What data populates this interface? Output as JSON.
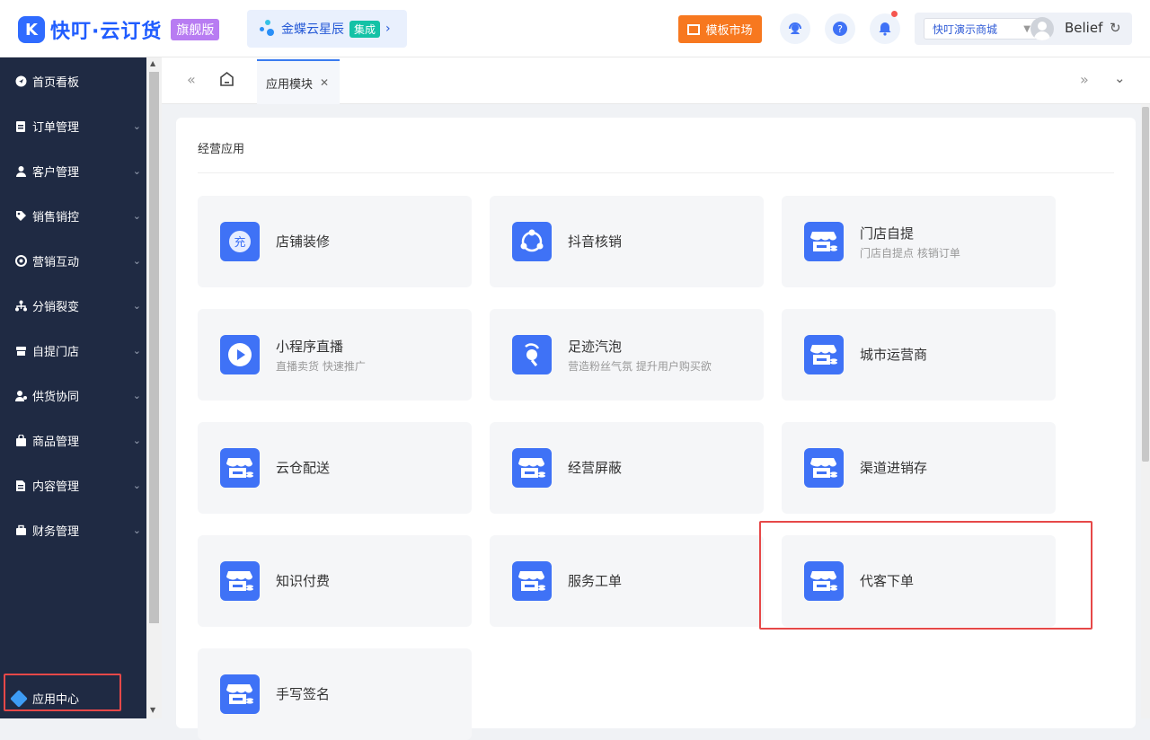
{
  "header": {
    "logo_text": "快叮·云订货",
    "edition": "旗舰版",
    "kingdee_text": "金蝶云星辰",
    "kingdee_badge": "集成",
    "template_market": "模板市场",
    "store": "快叮演示商城",
    "username": "Belief"
  },
  "sidebar": {
    "items": [
      {
        "label": "首页看板",
        "icon": "send-icon"
      },
      {
        "label": "订单管理",
        "icon": "clipboard-icon"
      },
      {
        "label": "客户管理",
        "icon": "user-icon"
      },
      {
        "label": "销售销控",
        "icon": "tag-icon"
      },
      {
        "label": "营销互动",
        "icon": "target-icon"
      },
      {
        "label": "分销裂变",
        "icon": "hierarchy-icon"
      },
      {
        "label": "自提门店",
        "icon": "store-icon"
      },
      {
        "label": "供货协同",
        "icon": "user-share-icon"
      },
      {
        "label": "商品管理",
        "icon": "bag-icon"
      },
      {
        "label": "内容管理",
        "icon": "document-icon"
      },
      {
        "label": "财务管理",
        "icon": "briefcase-icon"
      }
    ],
    "app_center": "应用中心"
  },
  "tabs": {
    "active": "应用模块"
  },
  "main": {
    "section_title": "经营应用",
    "cards": [
      {
        "title": "店铺装修",
        "desc": "",
        "icon": "decoration-icon"
      },
      {
        "title": "抖音核销",
        "desc": "",
        "icon": "share-circle-icon"
      },
      {
        "title": "门店自提",
        "desc": "门店自提点 核销订单",
        "icon": "storefront-icon"
      },
      {
        "title": "小程序直播",
        "desc": "直播卖货 快速推广",
        "icon": "play-icon"
      },
      {
        "title": "足迹汽泡",
        "desc": "营造粉丝气氛 提升用户购买欲",
        "icon": "bubble-icon"
      },
      {
        "title": "城市运营商",
        "desc": "",
        "icon": "storefront-icon"
      },
      {
        "title": "云仓配送",
        "desc": "",
        "icon": "storefront-icon"
      },
      {
        "title": "经营屏蔽",
        "desc": "",
        "icon": "storefront-icon"
      },
      {
        "title": "渠道进销存",
        "desc": "",
        "icon": "storefront-icon"
      },
      {
        "title": "知识付费",
        "desc": "",
        "icon": "storefront-icon"
      },
      {
        "title": "服务工单",
        "desc": "",
        "icon": "storefront-icon"
      },
      {
        "title": "代客下单",
        "desc": "",
        "icon": "storefront-icon"
      },
      {
        "title": "手写签名",
        "desc": "",
        "icon": "storefront-icon"
      }
    ]
  },
  "colors": {
    "sidebar_bg": "#1f2a43",
    "accent": "#3f72f6",
    "highlight": "#e64848"
  }
}
